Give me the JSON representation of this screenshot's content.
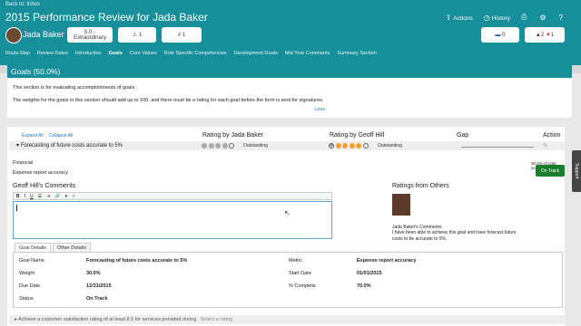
{
  "header": {
    "back_label": "Back to: Inbox",
    "title": "2015 Performance Review for Jada Baker",
    "actions": [
      {
        "label": "Actions",
        "icon": "share-icon"
      },
      {
        "label": "History",
        "icon": "clock-icon"
      },
      {
        "label": "",
        "icon": "print-icon"
      },
      {
        "label": "",
        "icon": "gear-icon"
      },
      {
        "label": "",
        "icon": "help-icon"
      }
    ],
    "employee_name": "Jada Baker",
    "rating_pill": {
      "score": "5.0 -",
      "label": "Extraordinary"
    },
    "warning_count": "1",
    "hash_count": "1",
    "comment_count": "0",
    "up_count": "2",
    "down_count": "1",
    "nav": [
      "Route Map",
      "Review Dates",
      "Introduction",
      "Goals",
      "Core Values",
      "Role Specific Competencies",
      "Development Goals",
      "Mid Year Comments",
      "Summary Section"
    ],
    "active_nav": "Goals"
  },
  "section": {
    "title": "Goals (50.0%)",
    "para1": "This section is for evaluating accomplishments of goals.",
    "para2": "The weights for the goals in this section should add up to 100, and there must be a rating for each goal before the form is sent for signatures.",
    "less": "Less"
  },
  "goals_table": {
    "expand_all": "Expand All",
    "collapse_all": "Collapse All",
    "col_rating_emp": "Rating by Jada Baker",
    "col_rating_mgr": "Rating by Geoff Hill",
    "col_gap": "Gap",
    "col_action": "Action",
    "goal_title": "Forecasting of future costs accurate to 5%",
    "emp_rating_label": "Outstanding",
    "mgr_rating_label": "Outstanding",
    "category": "Financial",
    "subcategory": "Expense report accuracy",
    "score_text": "30.0% of total score",
    "status_button": "On Track",
    "comments_title": "Geoff Hill's Comments",
    "others_title": "Ratings from Others",
    "others_name": "Jada Baker's Comments",
    "others_text": "I have been able to achieve this goal and have forecast future costs to be accurate to 5%.",
    "tabs": [
      "Goal Details",
      "Other Details"
    ],
    "details": {
      "goal_name_label": "Goal Name",
      "goal_name": "Forecasting of future costs accurate to 5%",
      "weight_label": "Weight",
      "weight": "30.0%",
      "due_label": "Due Date",
      "due": "12/31/2015",
      "status_label": "Status",
      "status": "On Track",
      "metric_label": "Metric",
      "metric": "Expense report accuracy",
      "start_label": "Start Date",
      "start": "01/01/2015",
      "complete_label": "% Complete",
      "complete": "70.0%"
    },
    "next_goal": "Achieve a customer satisfaction rating of at least 8.5 for services provided during",
    "select_rating": "Select a rating"
  },
  "support_label": "Support",
  "colors": {
    "teal": "#168f9a",
    "green": "#1a7d2c",
    "orange": "#f0a030"
  }
}
